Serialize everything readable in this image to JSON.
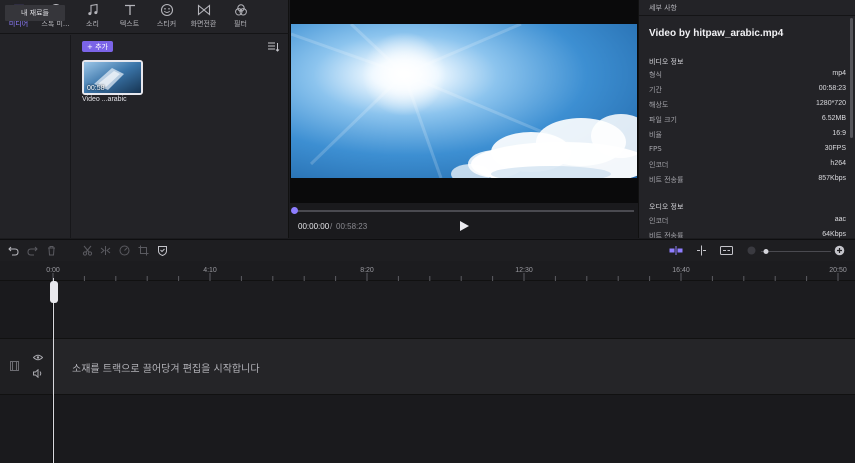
{
  "media_tabs": [
    {
      "label": "미디어",
      "icon": "media-icon",
      "active": true
    },
    {
      "label": "스톡 미...",
      "icon": "globe-icon",
      "active": false
    },
    {
      "label": "소리",
      "icon": "music-note-icon",
      "active": false
    },
    {
      "label": "텍스트",
      "icon": "text-icon",
      "active": false
    },
    {
      "label": "스티커",
      "icon": "sticker-icon",
      "active": false
    },
    {
      "label": "화면전환",
      "icon": "transition-icon",
      "active": false
    },
    {
      "label": "필터",
      "icon": "filter-icon",
      "active": false
    }
  ],
  "media": {
    "my_material_label": "내 재료들",
    "add_label": "+ 추가",
    "thumb_duration": "00:58",
    "thumb_name": "Video ...arabic"
  },
  "preview": {
    "time_current": "00:00:00",
    "time_separator": "/",
    "time_total": "00:58:23"
  },
  "details": {
    "header": "세부 사항",
    "file_title": "Video by hitpaw_arabic.mp4",
    "video_section": "비디오 정보",
    "video_rows": [
      {
        "key": "형식",
        "value": "mp4"
      },
      {
        "key": "기간",
        "value": "00:58:23"
      },
      {
        "key": "해상도",
        "value": "1280*720"
      },
      {
        "key": "파일 크기",
        "value": "6.52MB"
      },
      {
        "key": "비율",
        "value": "16:9"
      },
      {
        "key": "FPS",
        "value": "30FPS"
      },
      {
        "key": "인코더",
        "value": "h264"
      },
      {
        "key": "비트 전송률",
        "value": "857Kbps"
      }
    ],
    "audio_section": "오디오 정보",
    "audio_rows": [
      {
        "key": "인코더",
        "value": "aac"
      },
      {
        "key": "비트 전송률",
        "value": "64Kbps"
      }
    ]
  },
  "timeline": {
    "ruler_labels": [
      "0:00",
      "4:10",
      "8:20",
      "12:30",
      "16:40",
      "20:50"
    ],
    "drop_hint": "소재를 트랙으로 끌어당겨 편집을 시작합니다"
  },
  "colors": {
    "accent": "#7b64e8",
    "accent_light": "#8f7dff",
    "panel_bg": "#232327",
    "timeline_bg": "#151517"
  }
}
